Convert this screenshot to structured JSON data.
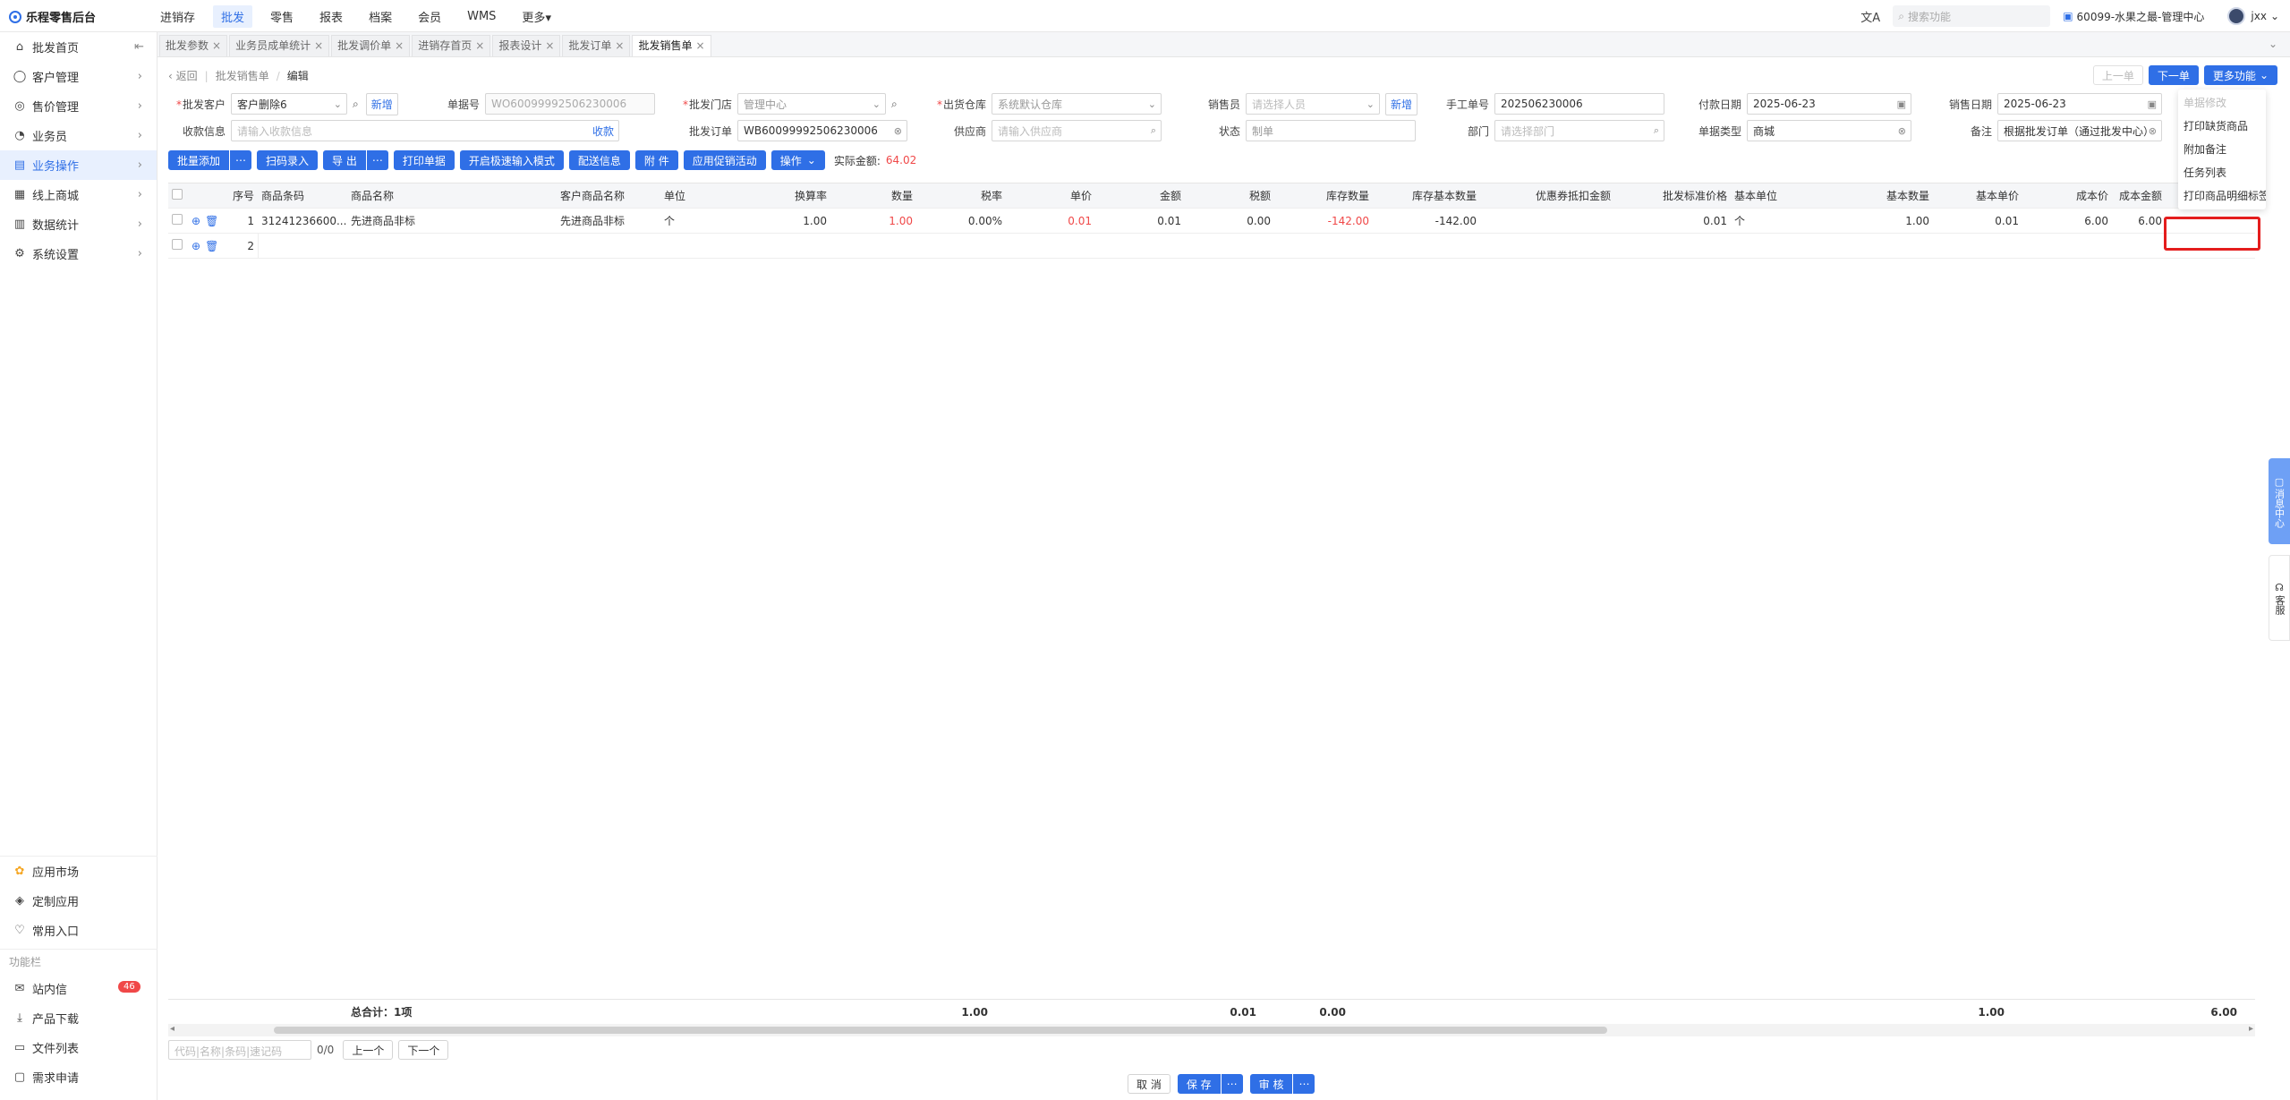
{
  "app": {
    "name": "乐程零售后台"
  },
  "topnav": [
    "进销存",
    "批发",
    "零售",
    "报表",
    "档案",
    "会员",
    "WMS",
    "更多"
  ],
  "topright": {
    "search_placeholder": "搜索功能",
    "store": "60099-水果之最-管理中心",
    "user": "jxx"
  },
  "sidebar": {
    "items": [
      "批发首页",
      "客户管理",
      "售价管理",
      "业务员",
      "业务操作",
      "线上商城",
      "数据统计",
      "系统设置"
    ],
    "bottom": [
      "应用市场",
      "定制应用",
      "常用入口"
    ],
    "section_title": "功能栏",
    "tools": [
      "站内信",
      "产品下载",
      "文件列表",
      "需求申请"
    ],
    "badge": "46"
  },
  "tabs": [
    {
      "label": "批发参数"
    },
    {
      "label": "业务员成单统计"
    },
    {
      "label": "批发调价单"
    },
    {
      "label": "进销存首页"
    },
    {
      "label": "报表设计"
    },
    {
      "label": "批发订单"
    },
    {
      "label": "批发销售单"
    }
  ],
  "breadcrumb": {
    "back": "返回",
    "parent": "批发销售单",
    "current": "编辑"
  },
  "nav_buttons": {
    "prev": "上一单",
    "next": "下一单",
    "more": "更多功能"
  },
  "form": {
    "row1": {
      "customer_label": "批发客户",
      "customer_value": "客户删除6",
      "customer_new": "新增",
      "docno_label": "单据号",
      "docno_value": "WO60099992506230006",
      "store_label": "批发门店",
      "store_value": "管理中心",
      "warehouse_label": "出货仓库",
      "warehouse_value": "系统默认仓库",
      "salesman_label": "销售员",
      "salesman_placeholder": "请选择人员",
      "salesman_new": "新增",
      "manual_label": "手工单号",
      "manual_value": "202506230006",
      "paydate_label": "付款日期",
      "paydate_value": "2025-06-23",
      "saledate_label": "销售日期",
      "saledate_value": "2025-06-23"
    },
    "row2": {
      "receipt_label": "收款信息",
      "receipt_placeholder": "请输入收款信息",
      "receipt_btn": "收款",
      "order_label": "批发订单",
      "order_value": "WB60099992506230006",
      "supplier_label": "供应商",
      "supplier_placeholder": "请输入供应商",
      "status_label": "状态",
      "status_value": "制单",
      "dept_label": "部门",
      "dept_placeholder": "请选择部门",
      "doctype_label": "单据类型",
      "doctype_value": "商城",
      "remark_label": "备注",
      "remark_value": "根据批发订单（通过批发中心）"
    }
  },
  "toolbar": {
    "batch_add": "批量添加",
    "scan": "扫码录入",
    "export": "导 出",
    "print": "打印单据",
    "quick_input": "开启极速输入模式",
    "delivery": "配送信息",
    "attach": "附 件",
    "promo": "应用促销活动",
    "ops": "操作",
    "amount_label": "实际金额:",
    "amount_value": "64.02"
  },
  "grid": {
    "headers": [
      "序号",
      "商品条码",
      "商品名称",
      "客户商品名称",
      "单位",
      "换算率",
      "数量",
      "税率",
      "单价",
      "金额",
      "税额",
      "库存数量",
      "库存基本数量",
      "优惠券抵扣金额",
      "批发标准价格",
      "基本单位",
      "基本数量",
      "基本单价",
      "成本价",
      "成本金额"
    ],
    "rows": [
      {
        "seq": "1",
        "barcode": "31241236600...",
        "name": "先进商品非标",
        "cust_name": "先进商品非标",
        "unit": "个",
        "rate": "1.00",
        "qty": "1.00",
        "tax": "0.00%",
        "price": "0.01",
        "amount": "0.01",
        "tax_amt": "0.00",
        "stock": "-142.00",
        "stock_base": "-142.00",
        "coupon": "",
        "std_price": "0.01",
        "base_unit": "个",
        "base_qty": "1.00",
        "base_price": "0.01",
        "cost": "6.00",
        "cost_amt": "6.00"
      },
      {
        "seq": "2"
      }
    ],
    "totals": {
      "label": "总合计：1项",
      "qty": "1.00",
      "amount": "0.01",
      "tax": "0.00",
      "base_qty": "1.00",
      "cost_amt": "6.00"
    }
  },
  "pager": {
    "placeholder": "代码|名称|条码|速记码",
    "count": "0/0",
    "prev": "上一个",
    "next": "下一个"
  },
  "bottom_actions": {
    "cancel": "取 消",
    "save": "保 存",
    "audit": "审 核"
  },
  "dropdown": [
    "单据修改",
    "打印缺货商品",
    "附加备注",
    "任务列表",
    "打印商品明细标签"
  ],
  "float": {
    "message_center": "消息中心",
    "service": "客服"
  }
}
